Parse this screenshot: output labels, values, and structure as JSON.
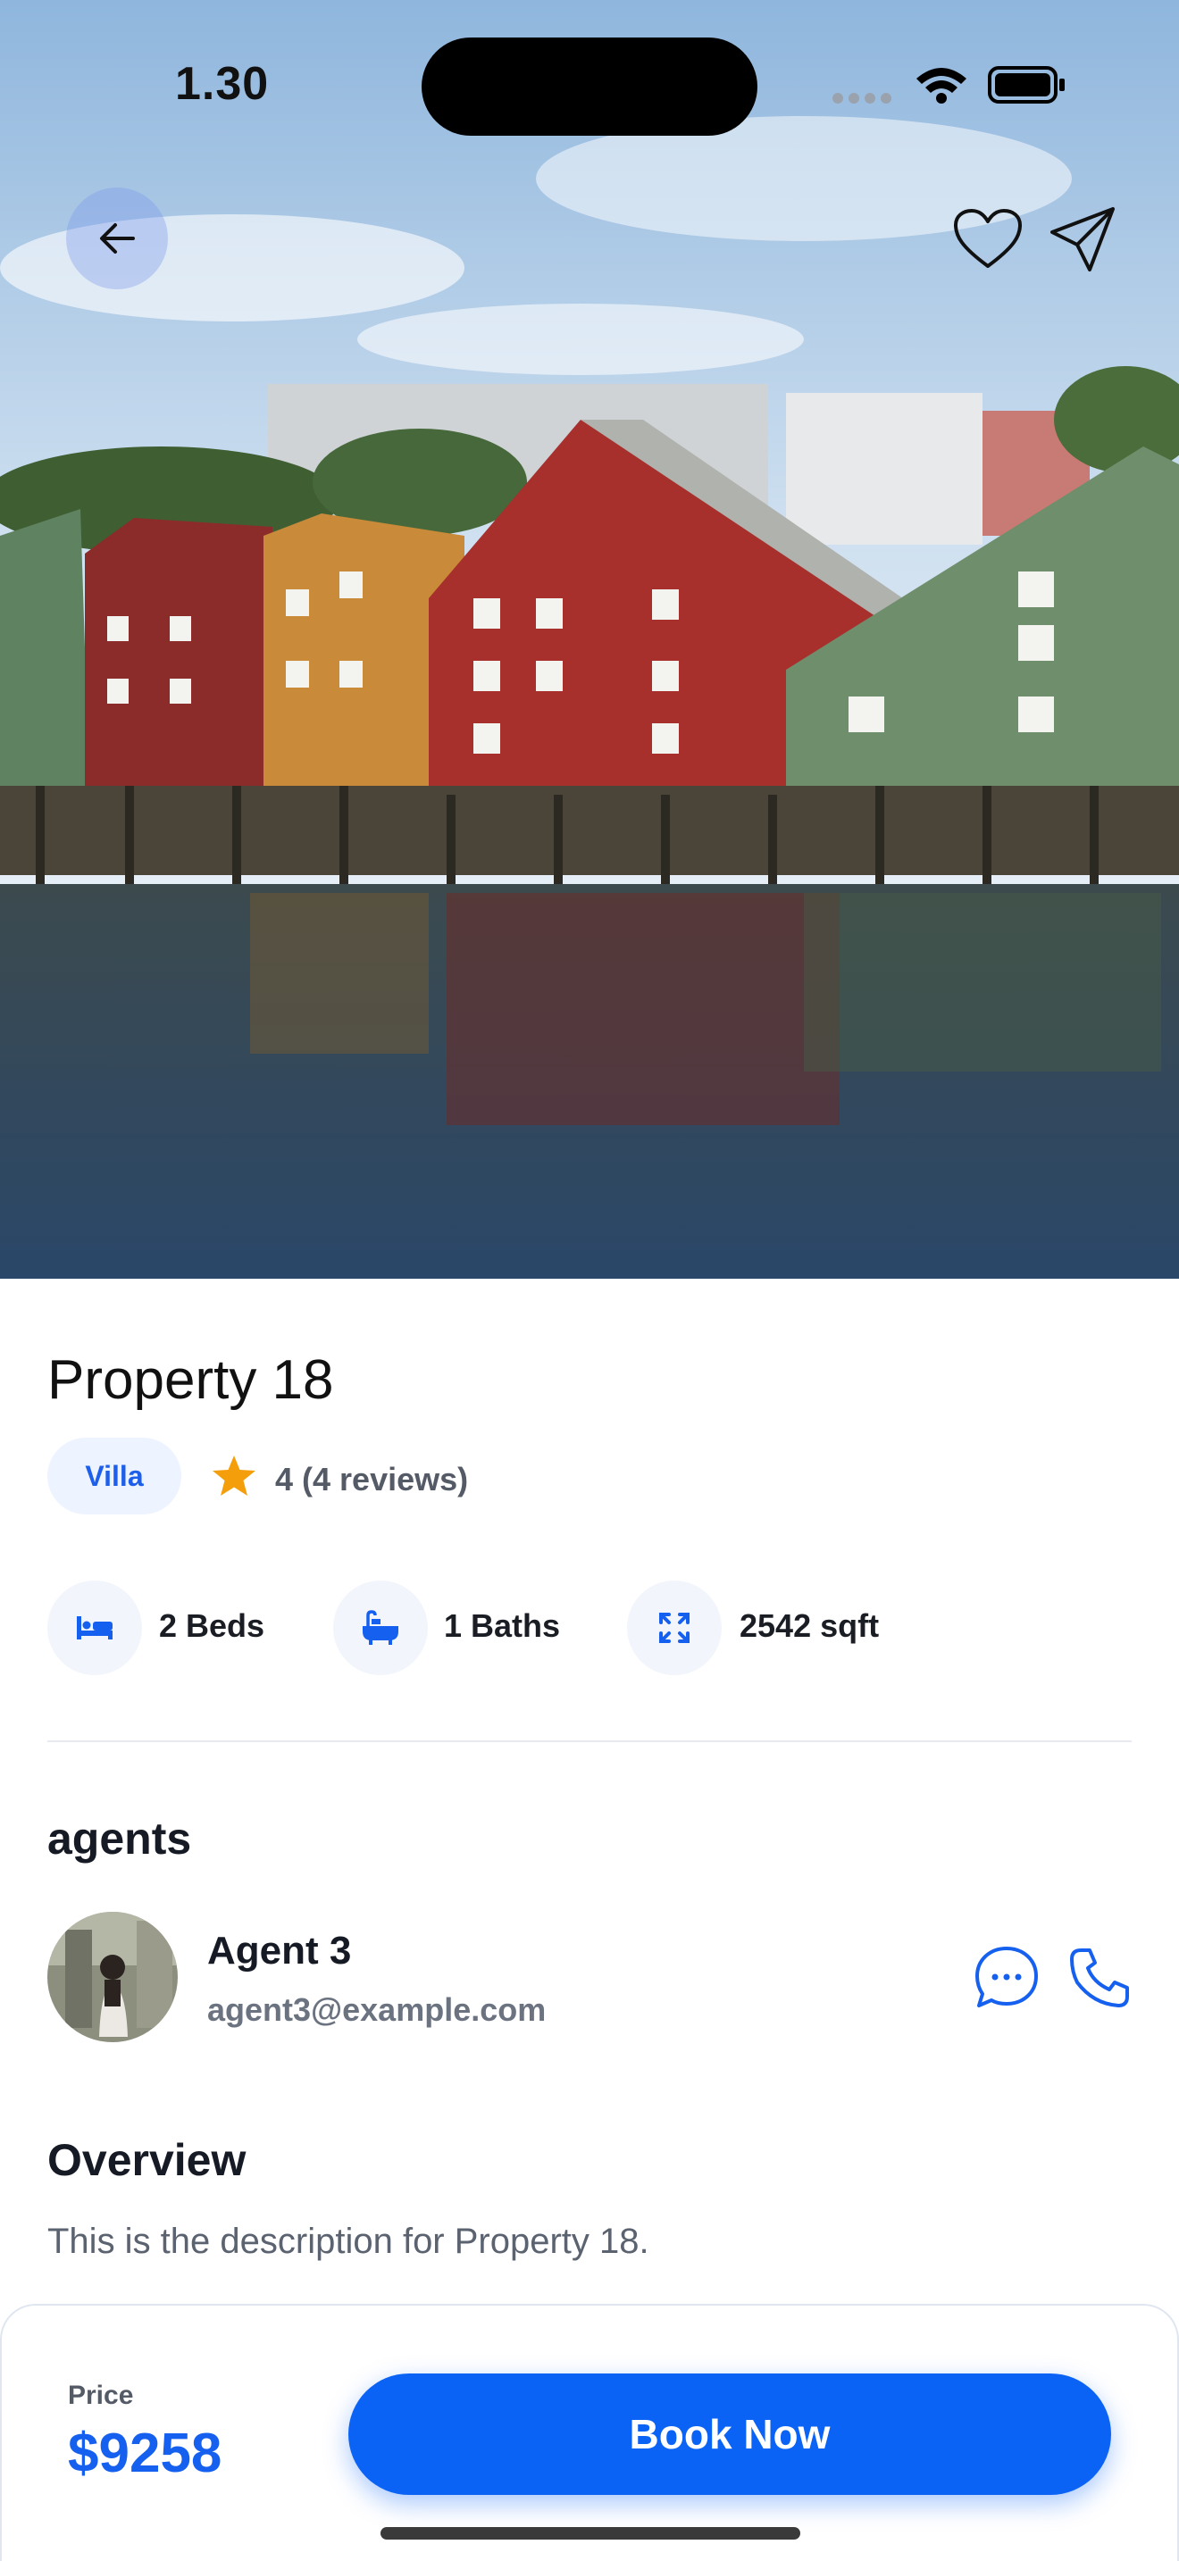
{
  "status_bar": {
    "time": "1.30"
  },
  "hero": {
    "image": "harbor-houses-photo"
  },
  "property": {
    "title": "Property 18",
    "type": "Villa",
    "rating_text": "4 (4 reviews)",
    "features": [
      {
        "icon": "bed-icon",
        "label": "2 Beds"
      },
      {
        "icon": "bathtub-icon",
        "label": "1 Baths"
      },
      {
        "icon": "expand-icon",
        "label": "2542 sqft"
      }
    ]
  },
  "agents": {
    "heading": "agents",
    "agent": {
      "name": "Agent 3",
      "email": "agent3@example.com"
    }
  },
  "overview": {
    "heading": "Overview",
    "text": "This is the description for Property 18."
  },
  "booking": {
    "price_label": "Price",
    "price": "$9258",
    "button_label": "Book Now"
  },
  "colors": {
    "accent": "#0b63f6",
    "star": "#f59e0b",
    "badge_bg": "#eef4ff"
  }
}
